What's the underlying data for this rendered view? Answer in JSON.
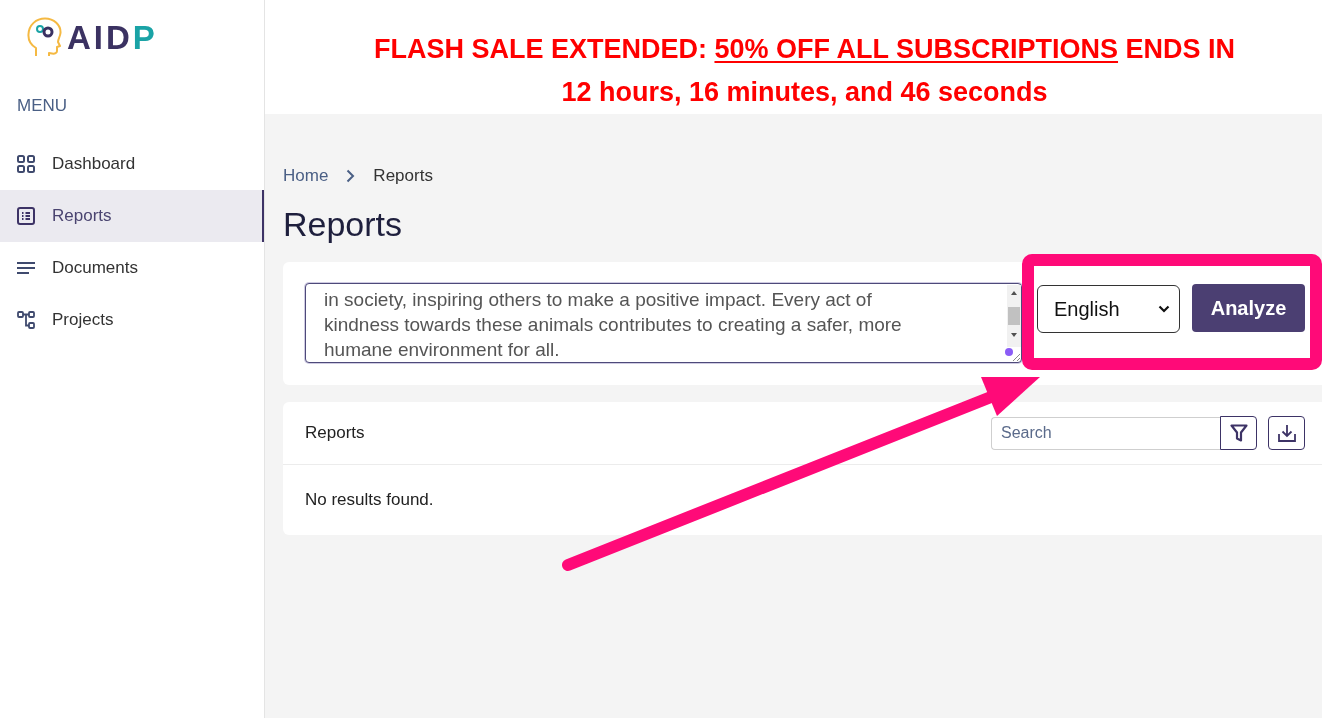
{
  "promo_banner": {
    "lines": [
      [
        {
          "text": "FLASH SALE EXTENDED:",
          "kind": "text"
        },
        {
          "text": "50% OFF ALL SUBSCRIPTIONS",
          "kind": "link"
        },
        {
          "text": "ENDS IN",
          "kind": "text"
        }
      ],
      [
        {
          "text": "12 hours, 16 minutes, and 46 seconds",
          "kind": "text"
        }
      ]
    ]
  },
  "sidebar": {
    "logo": {
      "text": "AID",
      "accent_text": "P"
    },
    "menu_title": "MENU",
    "items": [
      {
        "label": "Dashboard",
        "selected": false
      },
      {
        "label": "Reports",
        "selected": true
      },
      {
        "label": "Documents",
        "selected": false
      },
      {
        "label": "Projects",
        "selected": false
      }
    ]
  },
  "breadcrumb": [
    {
      "label": "Home",
      "kind": "link"
    },
    {
      "label": "Reports",
      "kind": "current"
    }
  ],
  "page_title": "Reports",
  "analyze_panel": {
    "text_value": "in society, inspiring others to make a positive impact. Every act of kindness towards these animals contributes to creating a safer, more humane environment for all.",
    "language": "English",
    "button": "Analyze"
  },
  "reports_table": {
    "title": "Reports",
    "search": {
      "placeholder": "Search"
    },
    "empty_message": "No results found."
  }
}
